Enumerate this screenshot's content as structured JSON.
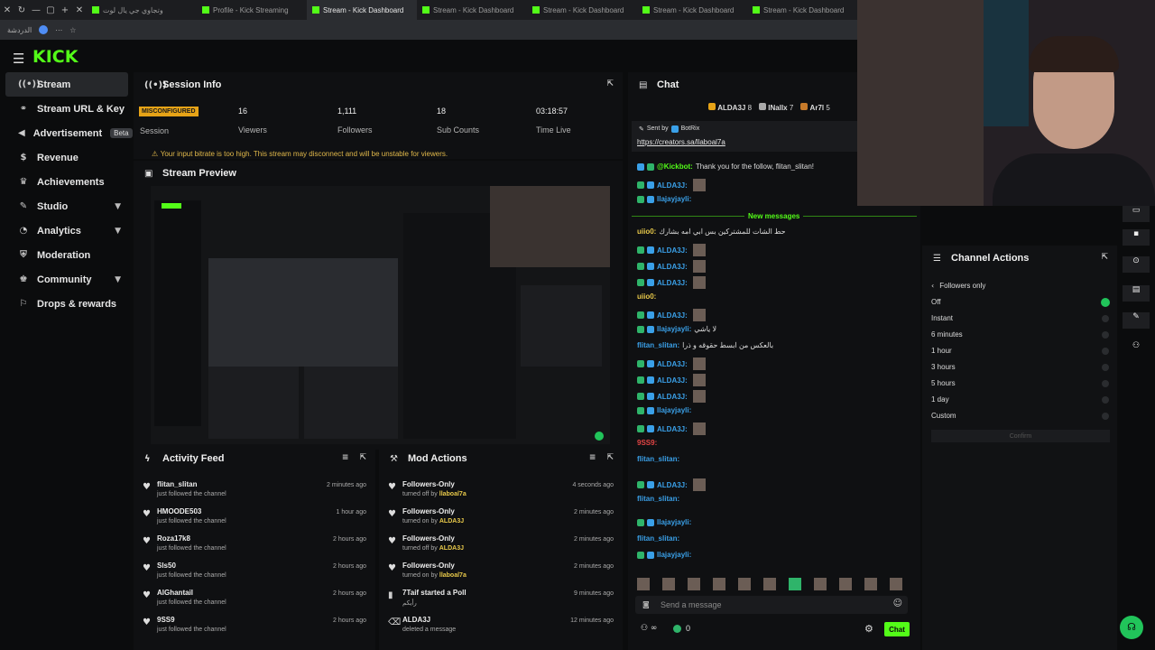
{
  "browser": {
    "tabs": [
      {
        "title": "وتجاوي جي يال لوت",
        "active": false
      },
      {
        "title": "Profile - Kick Streaming",
        "active": false
      },
      {
        "title": "Stream - Kick Dashboard",
        "active": true
      },
      {
        "title": "Stream - Kick Dashboard",
        "active": false
      },
      {
        "title": "Stream - Kick Dashboard",
        "active": false
      },
      {
        "title": "Stream - Kick Dashboard",
        "active": false
      },
      {
        "title": "Stream - Kick Dashboard",
        "active": false
      }
    ],
    "address_label": "الدردشة"
  },
  "header": {
    "logo": "KICK"
  },
  "sidebar": {
    "items": [
      {
        "label": "Stream",
        "icon": "stream-icon",
        "active": true
      },
      {
        "label": "Stream URL & Key",
        "icon": "link-icon"
      },
      {
        "label": "Advertisement",
        "icon": "megaphone-icon",
        "badge": "Beta"
      },
      {
        "label": "Revenue",
        "icon": "revenue-icon"
      },
      {
        "label": "Achievements",
        "icon": "trophy-icon"
      },
      {
        "label": "Studio",
        "icon": "studio-icon",
        "expandable": true
      },
      {
        "label": "Analytics",
        "icon": "analytics-icon",
        "expandable": true
      },
      {
        "label": "Moderation",
        "icon": "shield-icon"
      },
      {
        "label": "Community",
        "icon": "community-icon",
        "expandable": true
      },
      {
        "label": "Drops & rewards",
        "icon": "drops-icon"
      }
    ]
  },
  "session": {
    "title": "Session Info",
    "status_badge": "MISCONFIGURED",
    "status_label": "Session",
    "stats": [
      {
        "value": "16",
        "label": "Viewers"
      },
      {
        "value": "1,111",
        "label": "Followers"
      },
      {
        "value": "18",
        "label": "Sub Counts"
      },
      {
        "value": "03:18:57",
        "label": "Time Live"
      }
    ],
    "warning": "Your input bitrate is too high. This stream may disconnect and will be unstable for viewers."
  },
  "preview": {
    "title": "Stream Preview"
  },
  "activity": {
    "title": "Activity Feed",
    "items": [
      {
        "name": "flitan_slitan",
        "desc": "just followed the channel",
        "time": "2 minutes ago"
      },
      {
        "name": "HMOODE503",
        "desc": "just followed the channel",
        "time": "1 hour ago"
      },
      {
        "name": "Roza17k8",
        "desc": "just followed the channel",
        "time": "2 hours ago"
      },
      {
        "name": "Sls50",
        "desc": "just followed the channel",
        "time": "2 hours ago"
      },
      {
        "name": "AlGhantail",
        "desc": "just followed the channel",
        "time": "2 hours ago"
      },
      {
        "name": "9SS9",
        "desc": "just followed the channel",
        "time": "2 hours ago"
      }
    ]
  },
  "mod": {
    "title": "Mod Actions",
    "items": [
      {
        "name": "Followers-Only",
        "desc": "turned off by",
        "by": "llaboal7a",
        "time": "4 seconds ago"
      },
      {
        "name": "Followers-Only",
        "desc": "turned on by",
        "by": "ALDA3J",
        "time": "2 minutes ago"
      },
      {
        "name": "Followers-Only",
        "desc": "turned off by",
        "by": "ALDA3J",
        "time": "2 minutes ago"
      },
      {
        "name": "Followers-Only",
        "desc": "turned on by",
        "by": "llaboal7a",
        "time": "2 minutes ago"
      },
      {
        "name": "7Taif started a Poll",
        "desc": "رأيكم",
        "by": "",
        "time": "9 minutes ago"
      },
      {
        "name": "ALDA3J",
        "desc": "deleted a message",
        "by": "",
        "time": "12 minutes ago"
      }
    ]
  },
  "chat": {
    "title": "Chat",
    "top_users": [
      {
        "name": "ALDA3J",
        "count": "8"
      },
      {
        "name": "INallx",
        "count": "7"
      },
      {
        "name": "Ar7l",
        "count": "5"
      }
    ],
    "pinned_sender": "Sent by",
    "pinned_bot": "BotRix",
    "pinned_link": "https://creators.sa/llaboal7a",
    "kickbot_user": "@Kickbot:",
    "kickbot_msg": "Thank you for the follow, flitan_slitan!",
    "new_messages_label": "New messages",
    "messages": [
      {
        "user": "ALDA3J:",
        "text": "",
        "color": "#3aa0e8"
      },
      {
        "user": "llajayjayli:",
        "text": "",
        "color": "#3aa0e8"
      },
      {
        "user": "uiio0:",
        "text": "حط الشات للمشتركين بس ابي امه بشارك",
        "color": "#e8c94a"
      },
      {
        "user": "ALDA3J:",
        "text": "",
        "color": "#3aa0e8"
      },
      {
        "user": "ALDA3J:",
        "text": "",
        "color": "#3aa0e8"
      },
      {
        "user": "ALDA3J:",
        "text": "",
        "color": "#3aa0e8"
      },
      {
        "user": "uiio0:",
        "text": "",
        "color": "#e8c94a"
      },
      {
        "user": "ALDA3J:",
        "text": "",
        "color": "#3aa0e8"
      },
      {
        "user": "llajayjayli:",
        "text": "لا ياشي",
        "color": "#3aa0e8"
      },
      {
        "user": "flitan_slitan:",
        "text": "بالعكس من ابسط حقوقه و ذرا",
        "color": "#3aa0e8"
      },
      {
        "user": "ALDA3J:",
        "text": "",
        "color": "#3aa0e8"
      },
      {
        "user": "ALDA3J:",
        "text": "",
        "color": "#3aa0e8"
      },
      {
        "user": "ALDA3J:",
        "text": "",
        "color": "#3aa0e8"
      },
      {
        "user": "llajayjayli:",
        "text": "",
        "color": "#3aa0e8"
      },
      {
        "user": "ALDA3J:",
        "text": "",
        "color": "#3aa0e8"
      },
      {
        "user": "9SS9:",
        "text": "",
        "color": "#e64545"
      },
      {
        "user": "flitan_slitan:",
        "text": "",
        "color": "#3aa0e8"
      },
      {
        "user": "ALDA3J:",
        "text": "",
        "color": "#3aa0e8"
      },
      {
        "user": "flitan_slitan:",
        "text": "",
        "color": "#3aa0e8"
      },
      {
        "user": "llajayjayli:",
        "text": "",
        "color": "#3aa0e8"
      },
      {
        "user": "flitan_slitan:",
        "text": "",
        "color": "#3aa0e8"
      },
      {
        "user": "llajayjayli:",
        "text": "",
        "color": "#3aa0e8"
      }
    ],
    "input_placeholder": "Send a message",
    "viewer_count": "0",
    "send_label": "Chat"
  },
  "channel_actions": {
    "title": "Channel Actions",
    "submenu": "Followers only",
    "options": [
      "Off",
      "Instant",
      "6 minutes",
      "1 hour",
      "3 hours",
      "5 hours",
      "1 day",
      "Custom"
    ],
    "selected": 0,
    "confirm_label": "Confirm"
  },
  "colors": {
    "accent": "#53fc18",
    "warning": "#e6a317"
  }
}
